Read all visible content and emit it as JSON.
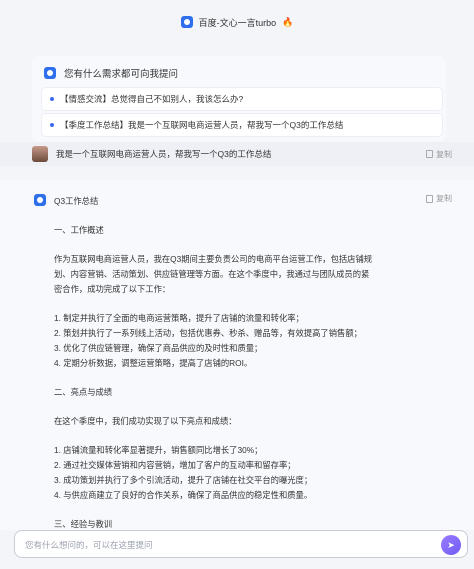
{
  "header": {
    "title": "百度-文心一言turbo",
    "emoji": "🔥"
  },
  "suggestions": {
    "title": "您有什么需求都可向我提问",
    "items": [
      "【情感交流】总觉得自己不如别人，我该怎么办?",
      "【季度工作总结】我是一个互联网电商运营人员，帮我写一个Q3的工作总结"
    ]
  },
  "user_message": {
    "text": "我是一个互联网电商运营人员，帮我写一个Q3的工作总结",
    "copy_label": "复制"
  },
  "answer": {
    "copy_label": "复制",
    "lines": [
      "Q3工作总结",
      "",
      "一、工作概述",
      "",
      "作为互联网电商运营人员，我在Q3期间主要负责公司的电商平台运营工作，包括店铺规",
      "划、内容营销、活动策划、供应链管理等方面。在这个季度中，我通过与团队成员的紧",
      "密合作，成功完成了以下工作：",
      "",
      "1. 制定并执行了全面的电商运营策略，提升了店铺的流量和转化率；",
      "2. 策划并执行了一系列线上活动，包括优惠券、秒杀、赠品等，有效提高了销售额；",
      "3. 优化了供应链管理，确保了商品供应的及时性和质量；",
      "4. 定期分析数据，调整运营策略，提高了店铺的ROI。",
      "",
      "二、亮点与成绩",
      "",
      "在这个季度中，我们成功实现了以下亮点和成绩：",
      "",
      "1. 店铺流量和转化率显著提升，销售额同比增长了30%；",
      "2. 通过社交媒体营销和内容营销，增加了客户的互动率和留存率；",
      "3. 成功策划并执行了多个引流活动，提升了店铺在社交平台的曝光度；",
      "4. 与供应商建立了良好的合作关系，确保了商品供应的稳定性和质量。",
      "",
      "三、经验与教训"
    ]
  },
  "input": {
    "placeholder": "您有什么想问的，可以在这里提问",
    "value": ""
  }
}
